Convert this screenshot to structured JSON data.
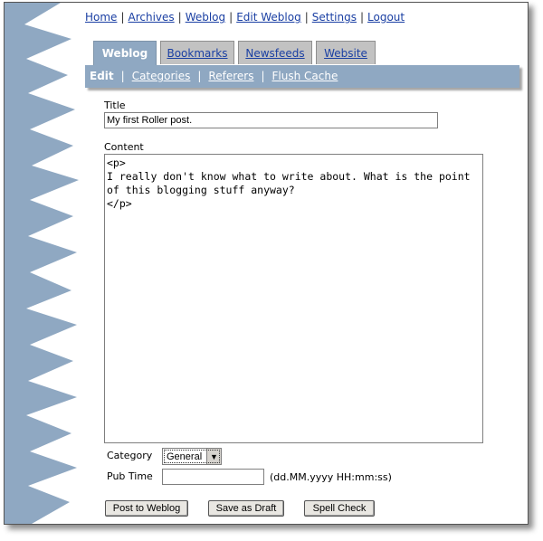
{
  "top_nav": {
    "home": "Home",
    "archives": "Archives",
    "weblog": "Weblog",
    "edit_weblog": "Edit Weblog",
    "settings": "Settings",
    "logout": "Logout",
    "separator": "|"
  },
  "tabs": [
    {
      "label": "Weblog",
      "active": true
    },
    {
      "label": "Bookmarks",
      "active": false
    },
    {
      "label": "Newsfeeds",
      "active": false
    },
    {
      "label": "Website",
      "active": false
    }
  ],
  "subnav": {
    "items": [
      "Edit",
      "Categories",
      "Referers",
      "Flush Cache"
    ],
    "active": "Edit",
    "separator": "|"
  },
  "form": {
    "title_label": "Title",
    "title_value": "My first Roller post.",
    "content_label": "Content",
    "content_value": "<p>\nI really don't know what to write about. What is the point\nof this blogging stuff anyway?\n</p>",
    "category_label": "Category",
    "category_value": "General",
    "pubtime_label": "Pub Time",
    "pubtime_value": "",
    "pubtime_hint": "(dd.MM.yyyy HH:mm:ss)"
  },
  "buttons": {
    "post": "Post to Weblog",
    "draft": "Save as Draft",
    "spell": "Spell Check"
  },
  "colors": {
    "accent": "#8fa8c2",
    "link": "#1a3fa3",
    "tab_inactive": "#c2c2c2"
  }
}
